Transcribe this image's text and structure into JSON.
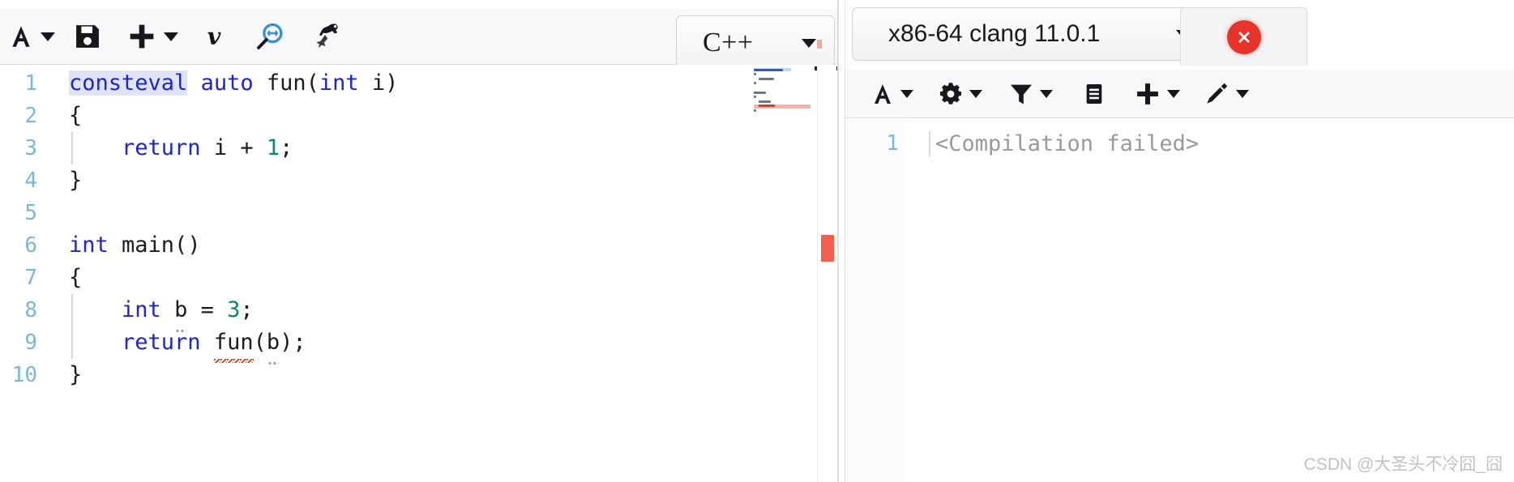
{
  "app": {
    "name": "compiler-explorer",
    "accent_error": "#e8332a",
    "accent_keyword": "#1d25d2",
    "accent_number": "#0b8a6b",
    "accent_linenumber": "#7ab8d4"
  },
  "editor": {
    "toolbar": {
      "buttons": [
        {
          "name": "font-size-button",
          "icon": "font-A-icon",
          "glyph": "A",
          "has_caret": true
        },
        {
          "name": "save-button",
          "icon": "floppy-save-icon",
          "glyph": "",
          "has_caret": false
        },
        {
          "name": "add-pane-button",
          "icon": "plus-icon",
          "glyph": "+",
          "has_caret": true
        },
        {
          "name": "vim-mode-button",
          "icon": "vim-icon",
          "glyph": "v",
          "has_caret": false
        },
        {
          "name": "find-button",
          "icon": "magnifier-plus-icon",
          "glyph": "",
          "has_caret": false
        },
        {
          "name": "format-button",
          "icon": "clang-format-icon",
          "glyph": "",
          "has_caret": false
        }
      ]
    },
    "language_select": {
      "label": "C++",
      "name": "language-select"
    },
    "code": {
      "language": "cpp",
      "lines": [
        {
          "number": "1",
          "indent": 0,
          "guide": false,
          "tokens": [
            {
              "text": "consteval",
              "style": "kw-hl"
            },
            {
              "text": " ",
              "style": "plain"
            },
            {
              "text": "auto",
              "style": "kw"
            },
            {
              "text": " fun(",
              "style": "plain"
            },
            {
              "text": "int",
              "style": "kw"
            },
            {
              "text": " i)",
              "style": "plain"
            }
          ]
        },
        {
          "number": "2",
          "indent": 0,
          "guide": false,
          "tokens": [
            {
              "text": "{",
              "style": "plain"
            }
          ]
        },
        {
          "number": "3",
          "indent": 0,
          "guide": true,
          "tokens": [
            {
              "text": "    ",
              "style": "plain"
            },
            {
              "text": "return",
              "style": "kw"
            },
            {
              "text": " i + ",
              "style": "plain"
            },
            {
              "text": "1",
              "style": "num"
            },
            {
              "text": ";",
              "style": "plain"
            }
          ]
        },
        {
          "number": "4",
          "indent": 0,
          "guide": false,
          "tokens": [
            {
              "text": "}",
              "style": "plain"
            }
          ]
        },
        {
          "number": "5",
          "indent": 0,
          "guide": false,
          "tokens": []
        },
        {
          "number": "6",
          "indent": 0,
          "guide": false,
          "tokens": [
            {
              "text": "int",
              "style": "kw"
            },
            {
              "text": " main()",
              "style": "plain"
            }
          ]
        },
        {
          "number": "7",
          "indent": 0,
          "guide": false,
          "tokens": [
            {
              "text": "{",
              "style": "plain"
            }
          ]
        },
        {
          "number": "8",
          "indent": 0,
          "guide": true,
          "tokens": [
            {
              "text": "    ",
              "style": "plain"
            },
            {
              "text": "int",
              "style": "kw"
            },
            {
              "text": " ",
              "style": "plain"
            },
            {
              "text": "b",
              "style": "dotted"
            },
            {
              "text": " = ",
              "style": "plain"
            },
            {
              "text": "3",
              "style": "num"
            },
            {
              "text": ";",
              "style": "plain"
            }
          ]
        },
        {
          "number": "9",
          "indent": 0,
          "guide": true,
          "tokens": [
            {
              "text": "    ",
              "style": "plain"
            },
            {
              "text": "return",
              "style": "kw"
            },
            {
              "text": " ",
              "style": "plain"
            },
            {
              "text": "fun",
              "style": "squiggle"
            },
            {
              "text": "(",
              "style": "plain"
            },
            {
              "text": "b",
              "style": "dotted"
            },
            {
              "text": ");",
              "style": "plain"
            }
          ]
        },
        {
          "number": "10",
          "indent": 0,
          "guide": false,
          "tokens": [
            {
              "text": "}",
              "style": "plain"
            }
          ]
        }
      ]
    },
    "scrollbar": {
      "name": "editor-vertical-scrollbar",
      "has_error_marker": true,
      "error_marker_color": "#f4604d"
    }
  },
  "output": {
    "compiler_select": {
      "label": "x86-64 clang 11.0.1",
      "name": "compiler-select"
    },
    "status": {
      "name": "compile-status-badge",
      "state": "error",
      "color": "#e8332a"
    },
    "toolbar": {
      "buttons": [
        {
          "name": "output-font-button",
          "icon": "font-A-icon",
          "glyph": "A",
          "has_caret": true
        },
        {
          "name": "compiler-options-button",
          "icon": "gear-icon",
          "glyph": "",
          "has_caret": true
        },
        {
          "name": "output-filters-button",
          "icon": "funnel-icon",
          "glyph": "",
          "has_caret": true
        },
        {
          "name": "output-libraries-button",
          "icon": "book-icon",
          "glyph": "",
          "has_caret": false
        },
        {
          "name": "add-tool-button",
          "icon": "plus-icon",
          "glyph": "+",
          "has_caret": true
        },
        {
          "name": "output-tools-button",
          "icon": "wand-icon",
          "glyph": "",
          "has_caret": true
        }
      ]
    },
    "asm": {
      "lines": [
        {
          "number": "1",
          "text": "<Compilation failed>"
        }
      ]
    }
  },
  "watermark": {
    "text": "CSDN @大圣头不冷囧_囧"
  }
}
